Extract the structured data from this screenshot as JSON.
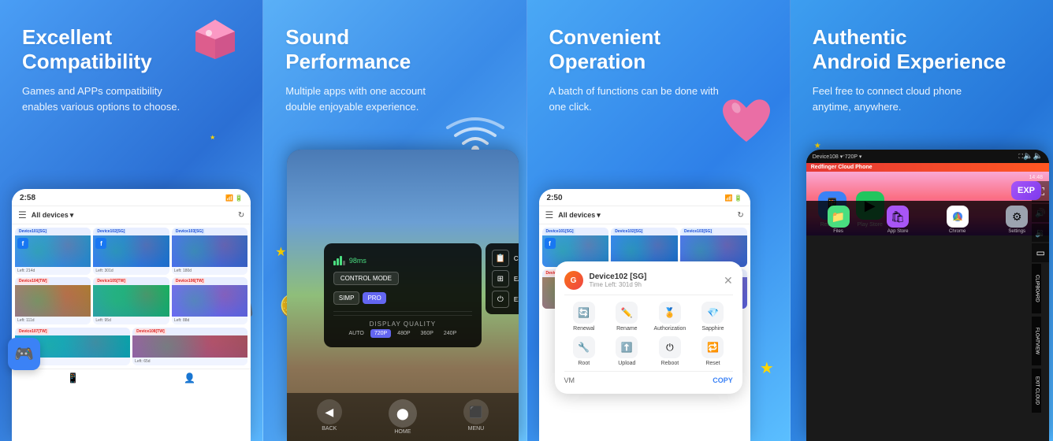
{
  "panels": [
    {
      "id": "panel-1",
      "title_line1": "Excellent",
      "title_line2": "Compatibility",
      "subtitle": "Games and APPs compatibility enables various options to choose.",
      "phone": {
        "time": "2:58",
        "toolbar_label": "All devices",
        "devices": [
          {
            "name": "Device101[SG]",
            "tag": "SG",
            "has_fb": true
          },
          {
            "name": "Device102[SG]",
            "tag": "SG",
            "has_fb": true
          },
          {
            "name": "Device103[SG]",
            "tag": "SG",
            "has_fb": false
          },
          {
            "name": "Device104[TW]",
            "tag": "TW",
            "has_fb": false
          },
          {
            "name": "Device105[TW]",
            "tag": "TW",
            "has_fb": false
          },
          {
            "name": "Device106[TW]",
            "tag": "TW",
            "has_fb": false
          },
          {
            "name": "Device107[TW]",
            "tag": "TW",
            "has_fb": false
          },
          {
            "name": "Device108[TW]",
            "tag": "TW",
            "has_fb": false
          }
        ]
      }
    },
    {
      "id": "panel-2",
      "title_line1": "Sound",
      "title_line2": "Performance",
      "subtitle": "Multiple apps with one account double enjoyable experience.",
      "menu": {
        "ping": "98ms",
        "control_mode_label": "CONTROL MODE",
        "simp_label": "SIMP",
        "pro_label": "PRO",
        "display_quality_label": "DISPLAY QUALITY",
        "quality_options": [
          "AUTO",
          "720P",
          "480P",
          "360P",
          "240P"
        ],
        "active_quality": "720P",
        "items": [
          "CLIPBOARD",
          "EASY SWITCH",
          "EXIT CLOUD"
        ],
        "nav_labels": [
          "BACK",
          "HOME",
          "MENU"
        ]
      }
    },
    {
      "id": "panel-3",
      "title_line1": "Convenient",
      "title_line2": "Operation",
      "subtitle": "A batch of functions can be done with one click.",
      "phone": {
        "time": "2:50",
        "toolbar_label": "All devices",
        "popup": {
          "device_name": "Device102 [SG]",
          "time_left": "Time Left: 301d 9h",
          "actions": [
            {
              "label": "Renewal",
              "icon": "🔄"
            },
            {
              "label": "Rename",
              "icon": "✏️"
            },
            {
              "label": "Authorization",
              "icon": "🏅"
            },
            {
              "label": "Sapphire",
              "icon": "💎"
            },
            {
              "label": "Root",
              "icon": "🔧"
            },
            {
              "label": "Upload",
              "icon": "⬆️"
            },
            {
              "label": "Reboot",
              "icon": "⏻"
            },
            {
              "label": "Reset",
              "icon": "🔁"
            }
          ],
          "vm_label": "VM",
          "copy_label": "COPY"
        }
      }
    },
    {
      "id": "panel-4",
      "title_line1": "Authentic",
      "title_line2": "Android Experience",
      "subtitle": "Feel free to connect cloud phone anytime, anywhere.",
      "phone": {
        "device_name": "Device108 ▾",
        "resolution": "720P ▾",
        "redfinger_label": "Redfinger Cloud Phone",
        "time": "14:48",
        "side_buttons": [
          "CLIPBOARD",
          "FLOATVIEW",
          "EXIT CLOUD"
        ],
        "taskbar": [
          {
            "label": "Files",
            "icon": "📁",
            "bg": "#4ade80"
          },
          {
            "label": "App Store",
            "icon": "🛍️",
            "bg": "#a855f7"
          },
          {
            "label": "Chrome",
            "icon": "🌐",
            "bg": "#ea4335"
          },
          {
            "label": "Settings",
            "icon": "⚙️",
            "bg": "#9ca3af"
          }
        ],
        "apps": [
          {
            "label": "Redfinger",
            "icon": "📱",
            "bg": "#3b82f6"
          },
          {
            "label": "Play Store",
            "icon": "▶️",
            "bg": "#22c55e"
          }
        ]
      }
    }
  ]
}
